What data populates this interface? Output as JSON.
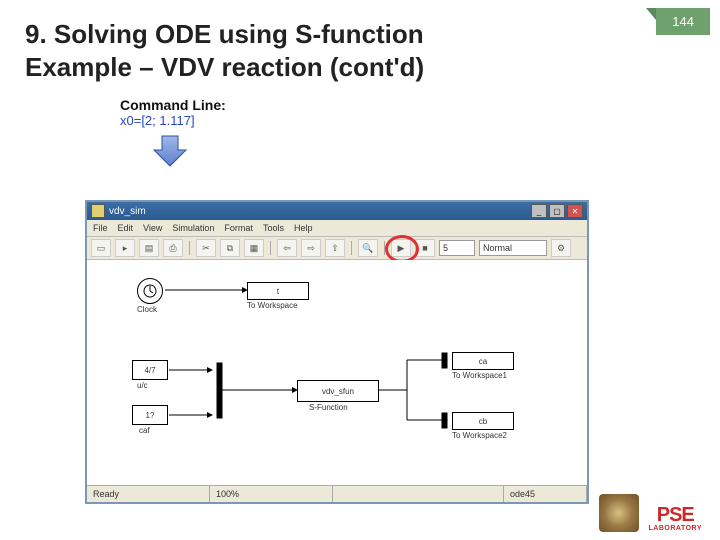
{
  "page_number": "144",
  "title_line1": "9. Solving ODE using S-function",
  "title_line2": "Example – VDV reaction (cont'd)",
  "command": {
    "label": "Command Line:",
    "value": "x0=[2; 1.117]"
  },
  "window": {
    "title": "vdv_sim",
    "menu": [
      "File",
      "Edit",
      "View",
      "Simulation",
      "Format",
      "Tools",
      "Help"
    ],
    "toolbar_time": "5",
    "toolbar_mode": "Normal",
    "status": {
      "left": "Ready",
      "pct": "100%",
      "right": "ode45"
    }
  },
  "blocks": {
    "clock_label": "Clock",
    "to_ws_t": "t",
    "to_ws_t_lbl": "To Workspace",
    "const1": "4/7",
    "const1_lbl": "u/c",
    "const2": "1?",
    "const2_lbl": "caf",
    "sfun": "vdv_sfun",
    "sfun_lbl": "S-Function",
    "to_ws_ca": "ca",
    "to_ws_ca_lbl": "To Workspace1",
    "to_ws_cb": "cb",
    "to_ws_cb_lbl": "To Workspace2"
  },
  "logo": {
    "pse": "PSE",
    "lab": "LABORATORY"
  }
}
